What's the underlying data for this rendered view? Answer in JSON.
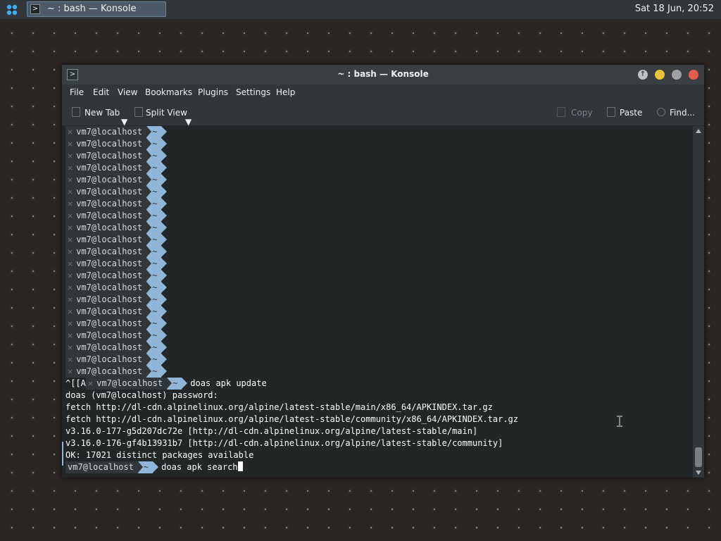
{
  "panel": {
    "task_title": "~ : bash — Konsole",
    "clock": "Sat 18 Jun, 20:52"
  },
  "window": {
    "title": "~ : bash — Konsole",
    "menu": [
      "File",
      "Edit",
      "View",
      "Bookmarks",
      "Plugins",
      "Settings",
      "Help"
    ],
    "toolbar": {
      "new_tab": "New Tab",
      "split_view": "Split View",
      "copy": "Copy",
      "paste": "Paste",
      "find": "Find..."
    }
  },
  "terminal": {
    "prompt_user": "vm7@localhost",
    "prompt_dir": "~",
    "prompt_mark": "✕",
    "line_13_prefix": "^[[A",
    "cmd_update": "doas apk update",
    "output": [
      "doas (vm7@localhost) password:",
      "fetch http://dl-cdn.alpinelinux.org/alpine/latest-stable/main/x86_64/APKINDEX.tar.gz",
      "fetch http://dl-cdn.alpinelinux.org/alpine/latest-stable/community/x86_64/APKINDEX.tar.gz",
      "v3.16.0-177-g5d207dc72e [http://dl-cdn.alpinelinux.org/alpine/latest-stable/main]",
      "v3.16.0-176-gf4b13931b7 [http://dl-cdn.alpinelinux.org/alpine/latest-stable/community]",
      "OK: 17021 distinct packages available"
    ],
    "cmd_current": "doas apk search"
  }
}
